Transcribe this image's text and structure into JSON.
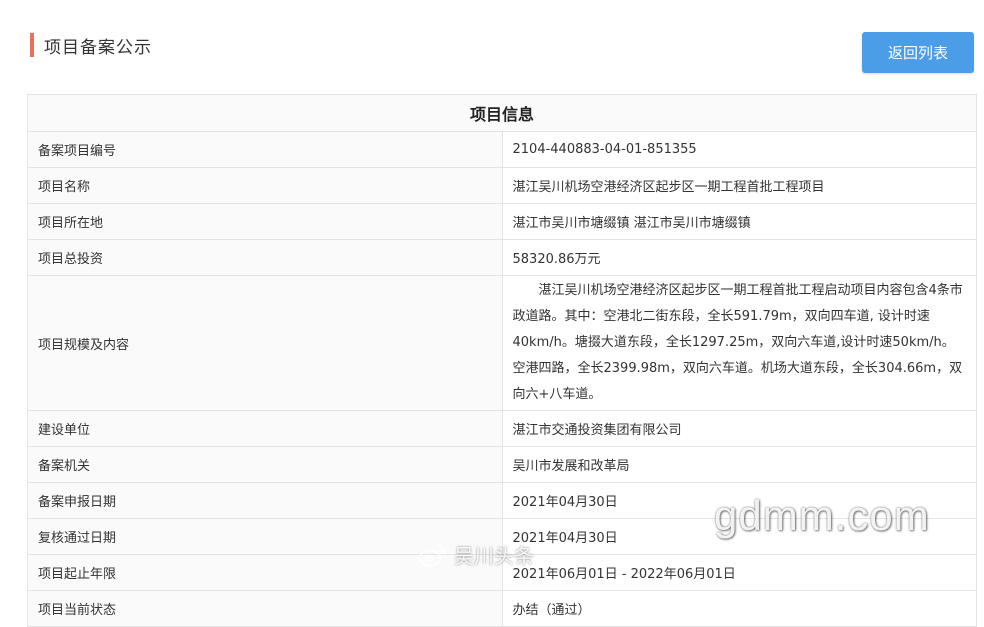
{
  "header": {
    "title": "项目备案公示",
    "back_label": "返回列表",
    "accent_color": "#e8735c",
    "button_color": "#4c9de8"
  },
  "table": {
    "heading": "项目信息",
    "rows": [
      {
        "label": "备案项目编号",
        "value": "2104-440883-04-01-851355"
      },
      {
        "label": "项目名称",
        "value": "湛江吴川机场空港经济区起步区一期工程首批工程项目"
      },
      {
        "label": "项目所在地",
        "value": "湛江市吴川市塘缀镇 湛江市吴川市塘缀镇"
      },
      {
        "label": "项目总投资",
        "value": "58320.86万元"
      },
      {
        "label": "项目规模及内容",
        "value": "湛江吴川机场空港经济区起步区一期工程首批工程启动项目内容包含4条市政道路。其中：空港北二街东段，全长591.79m，双向四车道, 设计时速40km/h。塘掇大道东段，全长1297.25m，双向六车道,设计时速50km/h。空港四路，全长2399.98m，双向六车道。机场大道东段，全长304.66m，双向六+八车道。"
      },
      {
        "label": "建设单位",
        "value": "湛江市交通投资集团有限公司"
      },
      {
        "label": "备案机关",
        "value": "吴川市发展和改革局"
      },
      {
        "label": "备案申报日期",
        "value": "2021年04月30日"
      },
      {
        "label": "复核通过日期",
        "value": "2021年04月30日"
      },
      {
        "label": "项目起止年限",
        "value": "2021年06月01日 - 2022年06月01日"
      },
      {
        "label": "项目当前状态",
        "value": "办结（通过）"
      }
    ]
  },
  "watermarks": {
    "site": "gdmm.com",
    "weibo_text": "吴川头条",
    "weibo_icon": "weibo-icon"
  }
}
